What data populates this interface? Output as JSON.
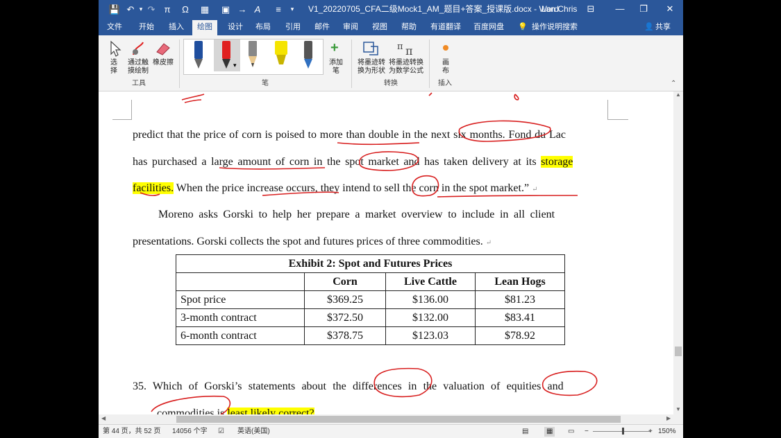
{
  "titlebar": {
    "doc_title": "V1_20220705_CFA二级Mock1_AM_题目+答案_授课版.docx - Word",
    "user": "Lan Chris",
    "qat": {
      "save": "💾",
      "undo": "↶",
      "redo": "↷",
      "pi": "π",
      "omega": "Ω",
      "table": "▦",
      "window": "▣",
      "arrow": "→",
      "font": "A",
      "align": "≡"
    }
  },
  "tabs": [
    "文件",
    "开始",
    "插入",
    "绘图",
    "设计",
    "布局",
    "引用",
    "邮件",
    "审阅",
    "视图",
    "帮助",
    "有道翻译",
    "百度网盘",
    "操作说明搜索"
  ],
  "share": "共享",
  "ribbon": {
    "select_label": "选择",
    "touch_draw_label": "通过触摸绘制",
    "eraser_label": "橡皮擦",
    "tools_group": "工具",
    "pens_group": "笔",
    "add_pen_label": "添加笔",
    "ink_to_shape_label": "将墨迹转换为形状",
    "ink_to_math_label": "将墨迹转换为数学公式",
    "convert_group": "转换",
    "canvas_label": "画布",
    "insert_group": "插入",
    "pen_colors": [
      "#1f4e9e",
      "#e02020",
      "#444444",
      "#f5e400",
      "#3070c0"
    ]
  },
  "document": {
    "line1": "predict that the price of corn is poised to more than double in the next six months. Fond du Lac",
    "line2_a": "has purchased a large amount of corn in the spot market and has taken delivery at its ",
    "line2_hl": "storage",
    "line3_hl": "facilities.",
    "line3_b": " When the price increase occurs, they intend to sell the corn in the spot market.”",
    "para2_line1": "Moreno asks Gorski to help her prepare a market overview to include in all client",
    "para2_line2": "presentations. Gorski collects the spot and futures prices of three commodities.",
    "question_line1": "35.  Which of Gorski’s statements about the differences in the valuation of equities and",
    "question_line2_a": "commodities is ",
    "question_line2_hl": "least likely correct?",
    "para_mark": "↵"
  },
  "exhibit": {
    "title": "Exhibit 2: Spot and Futures Prices",
    "headers": [
      "",
      "Corn",
      "Live Cattle",
      "Lean Hogs"
    ],
    "rows": [
      [
        "Spot price",
        "$369.25",
        "$136.00",
        "$81.23"
      ],
      [
        "3-month contract",
        "$372.50",
        "$132.00",
        "$83.41"
      ],
      [
        "6-month contract",
        "$378.75",
        "$123.03",
        "$78.92"
      ]
    ]
  },
  "status": {
    "page": "第 44 页，共 52 页",
    "words": "14056 个字",
    "language": "英语(美国)",
    "zoom": "150%"
  },
  "colors": {
    "word_blue": "#2b579a",
    "ink_red": "#d81e1e",
    "highlight": "#ffff00"
  }
}
